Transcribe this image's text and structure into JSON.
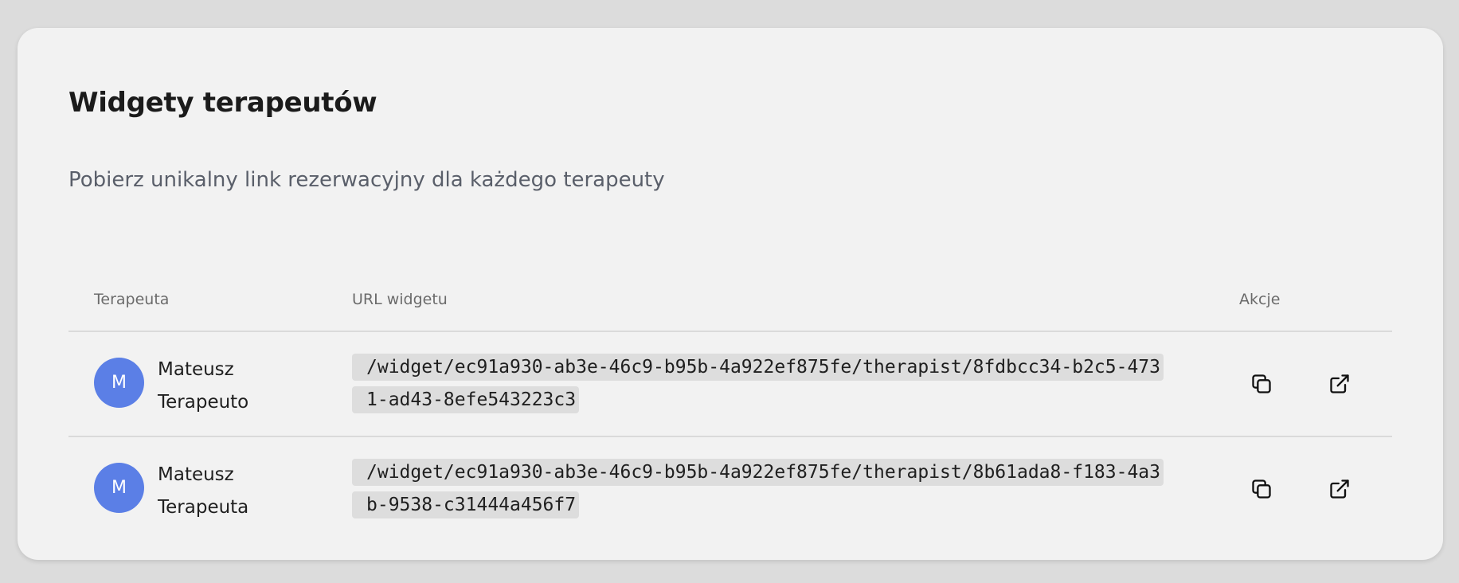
{
  "card": {
    "title": "Widgety terapeutów",
    "subtitle": "Pobierz unikalny link rezerwacyjny dla każdego terapeuty"
  },
  "table": {
    "headers": {
      "therapist": "Terapeuta",
      "url": "URL widgetu",
      "actions": "Akcje"
    },
    "rows": [
      {
        "initial": "M",
        "name": "Mateusz Terapeuto",
        "url": "/widget/ec91a930-ab3e-46c9-b95b-4a922ef875fe/therapist/8fdbcc34-b2c5-4731-ad43-8efe543223c3",
        "icons": [
          "copy-icon",
          "external-link-icon"
        ]
      },
      {
        "initial": "M",
        "name": "Mateusz Terapeuta",
        "url": "/widget/ec91a930-ab3e-46c9-b95b-4a922ef875fe/therapist/8b61ada8-f183-4a3b-9538-c31444a456f7",
        "icons": [
          "copy-icon",
          "external-link-icon"
        ]
      }
    ]
  },
  "colors": {
    "avatar": "#5b7fe6",
    "card_background": "#f2f2f2",
    "url_background": "#dddddd"
  }
}
